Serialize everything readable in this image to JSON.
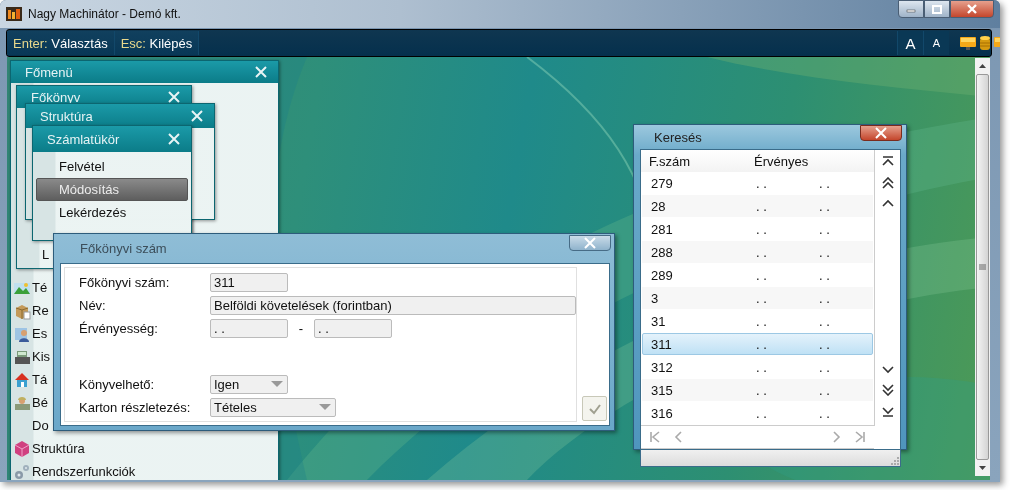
{
  "window": {
    "title": "Nagy Machinátor - Demó kft."
  },
  "toolbar": {
    "shortcuts": [
      {
        "key": "Enter:",
        "label": "Választás"
      },
      {
        "key": "Esc:",
        "label": "Kilépés"
      }
    ],
    "font_buttons": [
      {
        "label": "A",
        "kind": "large"
      },
      {
        "label": "A",
        "kind": "small"
      }
    ]
  },
  "menus": [
    {
      "title": "Főmenü",
      "items": [
        {
          "label": "Té",
          "kind": "landscape"
        },
        {
          "label": "Re",
          "kind": "package"
        },
        {
          "label": "Es",
          "kind": "person"
        },
        {
          "label": "Kis",
          "kind": "register"
        },
        {
          "label": "Tá",
          "kind": "house"
        },
        {
          "label": "Bé",
          "kind": "worker"
        },
        {
          "label": "Do",
          "kind": "none"
        },
        {
          "label": "Struktúra",
          "kind": "cube"
        },
        {
          "label": "Rendszerfunkciók",
          "kind": "gears"
        }
      ]
    },
    {
      "title": "Főkönyv",
      "items": [
        {
          "label": "L",
          "kind": "none"
        }
      ]
    },
    {
      "title": "Struktúra"
    },
    {
      "title": "Számlatükör",
      "items": [
        {
          "label": "Felvétel",
          "selected": false
        },
        {
          "label": "Módosítás",
          "selected": true
        },
        {
          "label": "Lekérdezés",
          "selected": false
        }
      ]
    }
  ],
  "dialog": {
    "title": "Főkönyvi szám",
    "sections": [
      {
        "fields": [
          {
            "label": "Főkönyvi szám:",
            "kind": "text",
            "value": "311"
          },
          {
            "label": "Név:",
            "kind": "text",
            "value": "Belföldi követelések (forintban)"
          },
          {
            "label": "Érvényesség:",
            "kind": "range",
            "from": ". .",
            "separator": "-",
            "to": ". ."
          }
        ]
      },
      {
        "fields": [
          {
            "label": "Könyvelhető:",
            "kind": "dropdown",
            "value": "Igen"
          },
          {
            "label": "Karton részletezés:",
            "kind": "dropdown",
            "value": "Tételes"
          }
        ]
      }
    ]
  },
  "search": {
    "title": "Keresés",
    "columns": [
      "F.szám",
      "Érvényes"
    ],
    "rows": [
      {
        "cells": [
          "279",
          ". .",
          ". ."
        ],
        "selected": false
      },
      {
        "cells": [
          "28",
          ". .",
          ". ."
        ],
        "selected": false
      },
      {
        "cells": [
          "281",
          ". .",
          ". ."
        ],
        "selected": false
      },
      {
        "cells": [
          "288",
          ". .",
          ". ."
        ],
        "selected": false
      },
      {
        "cells": [
          "289",
          ". .",
          ". ."
        ],
        "selected": false
      },
      {
        "cells": [
          "3",
          ". .",
          ". ."
        ],
        "selected": false
      },
      {
        "cells": [
          "31",
          ". .",
          ". ."
        ],
        "selected": false
      },
      {
        "cells": [
          "311",
          ". .",
          ". ."
        ],
        "selected": true
      },
      {
        "cells": [
          "312",
          ". .",
          ". ."
        ],
        "selected": false
      },
      {
        "cells": [
          "315",
          ". .",
          ". ."
        ],
        "selected": false
      },
      {
        "cells": [
          "316",
          ". .",
          ". ."
        ],
        "selected": false
      }
    ]
  }
}
